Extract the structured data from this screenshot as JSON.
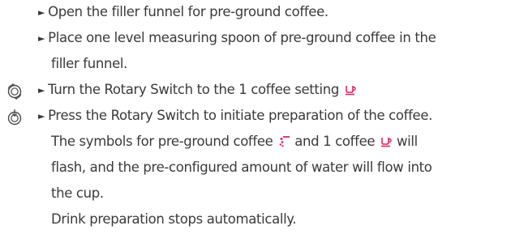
{
  "bullet_glyph": "►",
  "steps": [
    {
      "icon": "",
      "lines": [
        "Open the filler funnel for pre-ground coffee."
      ]
    },
    {
      "icon": "",
      "lines": [
        "Place one level measuring spoon of pre-ground coffee in the",
        "filler funnel."
      ]
    },
    {
      "icon": "rotary-switch-turn-icon",
      "lines": [
        "Turn the Rotary Switch to the 1 coffee setting"
      ],
      "symbol": "one-coffee-cup-icon"
    },
    {
      "icon": "rotary-switch-press-icon",
      "lines": [
        "Press the Rotary Switch to initiate preparation of the coffee.",
        "The symbols for pre-ground coffee",
        "and 1 coffee",
        "will",
        "flash, and the pre-configured amount of water will flow into",
        "the cup.",
        "Drink preparation stops automatically."
      ],
      "symbols": [
        "pre-ground-coffee-icon",
        "one-coffee-cup-icon"
      ]
    }
  ],
  "colors": {
    "text": "#3a3a3a",
    "symbol_accent": "#e0245e",
    "icon_stroke": "#4a4a4a"
  }
}
